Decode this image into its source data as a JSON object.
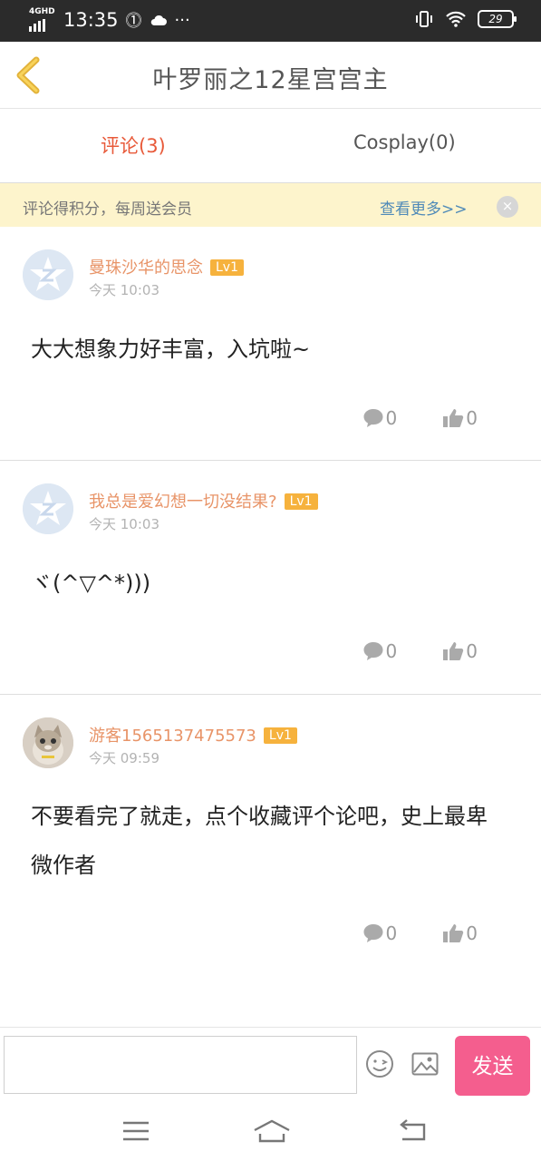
{
  "status_bar": {
    "network": "4GHD",
    "time": "13:35",
    "battery": "29"
  },
  "header": {
    "title": "叶罗丽之12星宫宫主"
  },
  "tabs": [
    {
      "label": "评论(3)",
      "active": true
    },
    {
      "label": "Cosplay(0)",
      "active": false
    }
  ],
  "notice": {
    "text": "评论得积分，每周送会员",
    "more_link": "查看更多>>",
    "close_icon": "×"
  },
  "comments": [
    {
      "username": "曼珠沙华的思念",
      "level": "Lv1",
      "time": "今天 10:03",
      "text": "大大想象力好丰富，入坑啦~",
      "reply_count": "0",
      "like_count": "0",
      "avatar": "default-avatar"
    },
    {
      "username": "我总是爱幻想一切没结果?",
      "level": "Lv1",
      "time": "今天 10:03",
      "text": "ヾ(^▽^*)))",
      "reply_count": "0",
      "like_count": "0",
      "avatar": "default-avatar"
    },
    {
      "username": "游客1565137475573",
      "level": "Lv1",
      "time": "今天 09:59",
      "text": "不要看完了就走，点个收藏评个论吧，史上最卑微作者",
      "reply_count": "0",
      "like_count": "0",
      "avatar": "cat-photo-avatar"
    }
  ],
  "input_bar": {
    "input_value": "",
    "send_label": "发送"
  },
  "colors": {
    "accent_tab": "#e85a3a",
    "username": "#e89468",
    "level_badge": "#f6b23d",
    "send_button": "#f45e8e",
    "notice_bg": "#fdf4cc",
    "back_arrow": "#e2b23a"
  }
}
